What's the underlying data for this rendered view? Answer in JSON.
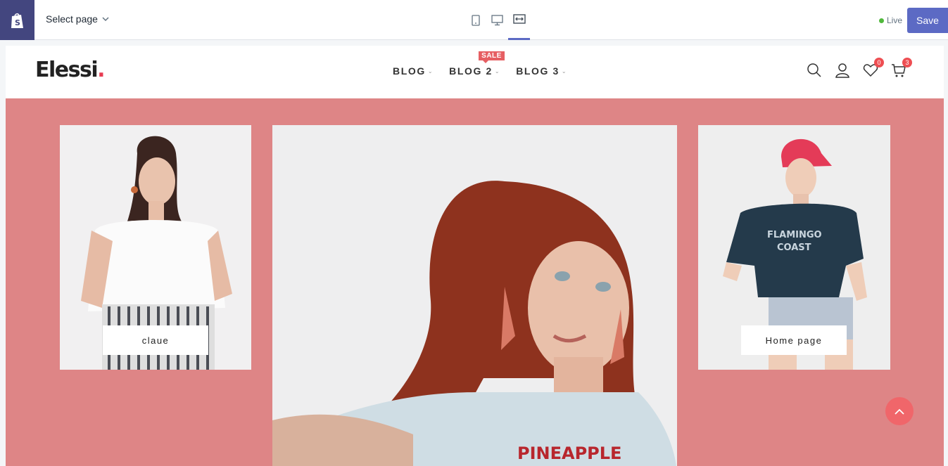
{
  "editor": {
    "select_page_label": "Select page",
    "devices": [
      {
        "name": "mobile-icon",
        "active": false
      },
      {
        "name": "desktop-icon",
        "active": false
      },
      {
        "name": "full-width-icon",
        "active": true
      }
    ],
    "live_label": "Live",
    "save_label": "Save",
    "accent_color": "#5c6ac4"
  },
  "store": {
    "brand": "Elessi",
    "brand_dot": ".",
    "nav": [
      {
        "label": "BLOG",
        "badge": ""
      },
      {
        "label": "BLOG 2",
        "badge": "SALE"
      },
      {
        "label": "BLOG 3",
        "badge": ""
      }
    ],
    "icons": [
      "search-icon",
      "account-icon",
      "wishlist-icon",
      "cart-icon"
    ],
    "wishlist_count": "0",
    "cart_count": "3",
    "background_color": "#de8586"
  },
  "banners": [
    {
      "label": "claue"
    },
    {
      "label": "PINEAPPLE"
    },
    {
      "label": "Home page"
    }
  ]
}
